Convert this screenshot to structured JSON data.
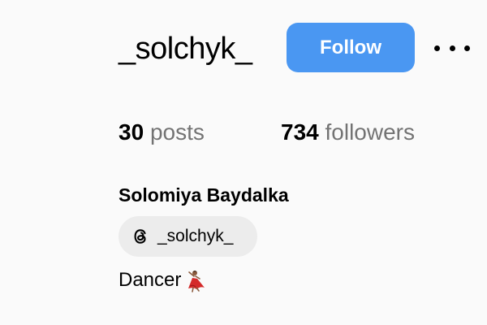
{
  "profile": {
    "username": "_solchyk_",
    "full_name": "Solomiya Baydalka",
    "bio": "Dancer"
  },
  "actions": {
    "follow_label": "Follow",
    "follow_color": "#4a97f2",
    "more_icon": "more-dots-icon"
  },
  "stats": {
    "posts_count": "30",
    "posts_label": "posts",
    "followers_count": "734",
    "followers_label": "followers"
  },
  "threads": {
    "icon": "threads-icon",
    "handle": "_solchyk_"
  },
  "bio_emoji_icon": "dancer-emoji-icon"
}
